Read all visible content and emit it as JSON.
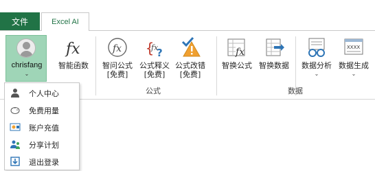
{
  "tabs": {
    "file": "文件",
    "excel_ai": "Excel AI"
  },
  "user": {
    "name": "chrisfang",
    "caret": "⌄"
  },
  "ribbon": {
    "buttons": [
      {
        "label": "智能函数",
        "label2": ""
      },
      {
        "label": "智问公式",
        "label2": "[免费]"
      },
      {
        "label": "公式释义",
        "label2": "[免费]"
      },
      {
        "label": "公式改错",
        "label2": "[免费]"
      },
      {
        "label": "智换公式",
        "label2": ""
      },
      {
        "label": "智换数据",
        "label2": ""
      },
      {
        "label": "数据分析",
        "label2": "⌄"
      },
      {
        "label": "数据生成",
        "label2": "⌄"
      }
    ],
    "groups": {
      "formula": "公式",
      "data": "数据"
    }
  },
  "menu": {
    "items": [
      {
        "label": "个人中心",
        "icon": "person-icon"
      },
      {
        "label": "免费用量",
        "icon": "piggy-bank-icon"
      },
      {
        "label": "账户充值",
        "icon": "recharge-icon"
      },
      {
        "label": "分享计划",
        "icon": "share-users-icon"
      },
      {
        "label": "退出登录",
        "icon": "logout-icon"
      }
    ]
  },
  "colors": {
    "accent": "#217346",
    "user_button_bg": "#9fd5b7"
  }
}
